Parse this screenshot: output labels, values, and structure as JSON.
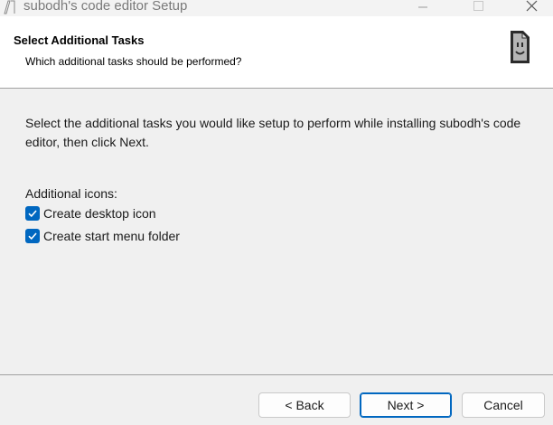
{
  "window": {
    "title": "subodh's code editor Setup"
  },
  "header": {
    "title": "Select Additional Tasks",
    "subtitle": "Which additional tasks should be performed?",
    "logo_icon": "setup-wizard-logo"
  },
  "main": {
    "intro": "Select the additional tasks you would like setup to perform while installing subodh's code editor, then click Next.",
    "group_label": "Additional icons:",
    "tasks": [
      {
        "label": "Create desktop icon",
        "checked": true
      },
      {
        "label": "Create start menu folder",
        "checked": true
      }
    ]
  },
  "footer": {
    "back_label": "< Back",
    "next_label": "Next >",
    "cancel_label": "Cancel"
  },
  "colors": {
    "accent": "#0067c0",
    "header_bg": "#ffffff",
    "body_bg": "#f0f0f0"
  }
}
